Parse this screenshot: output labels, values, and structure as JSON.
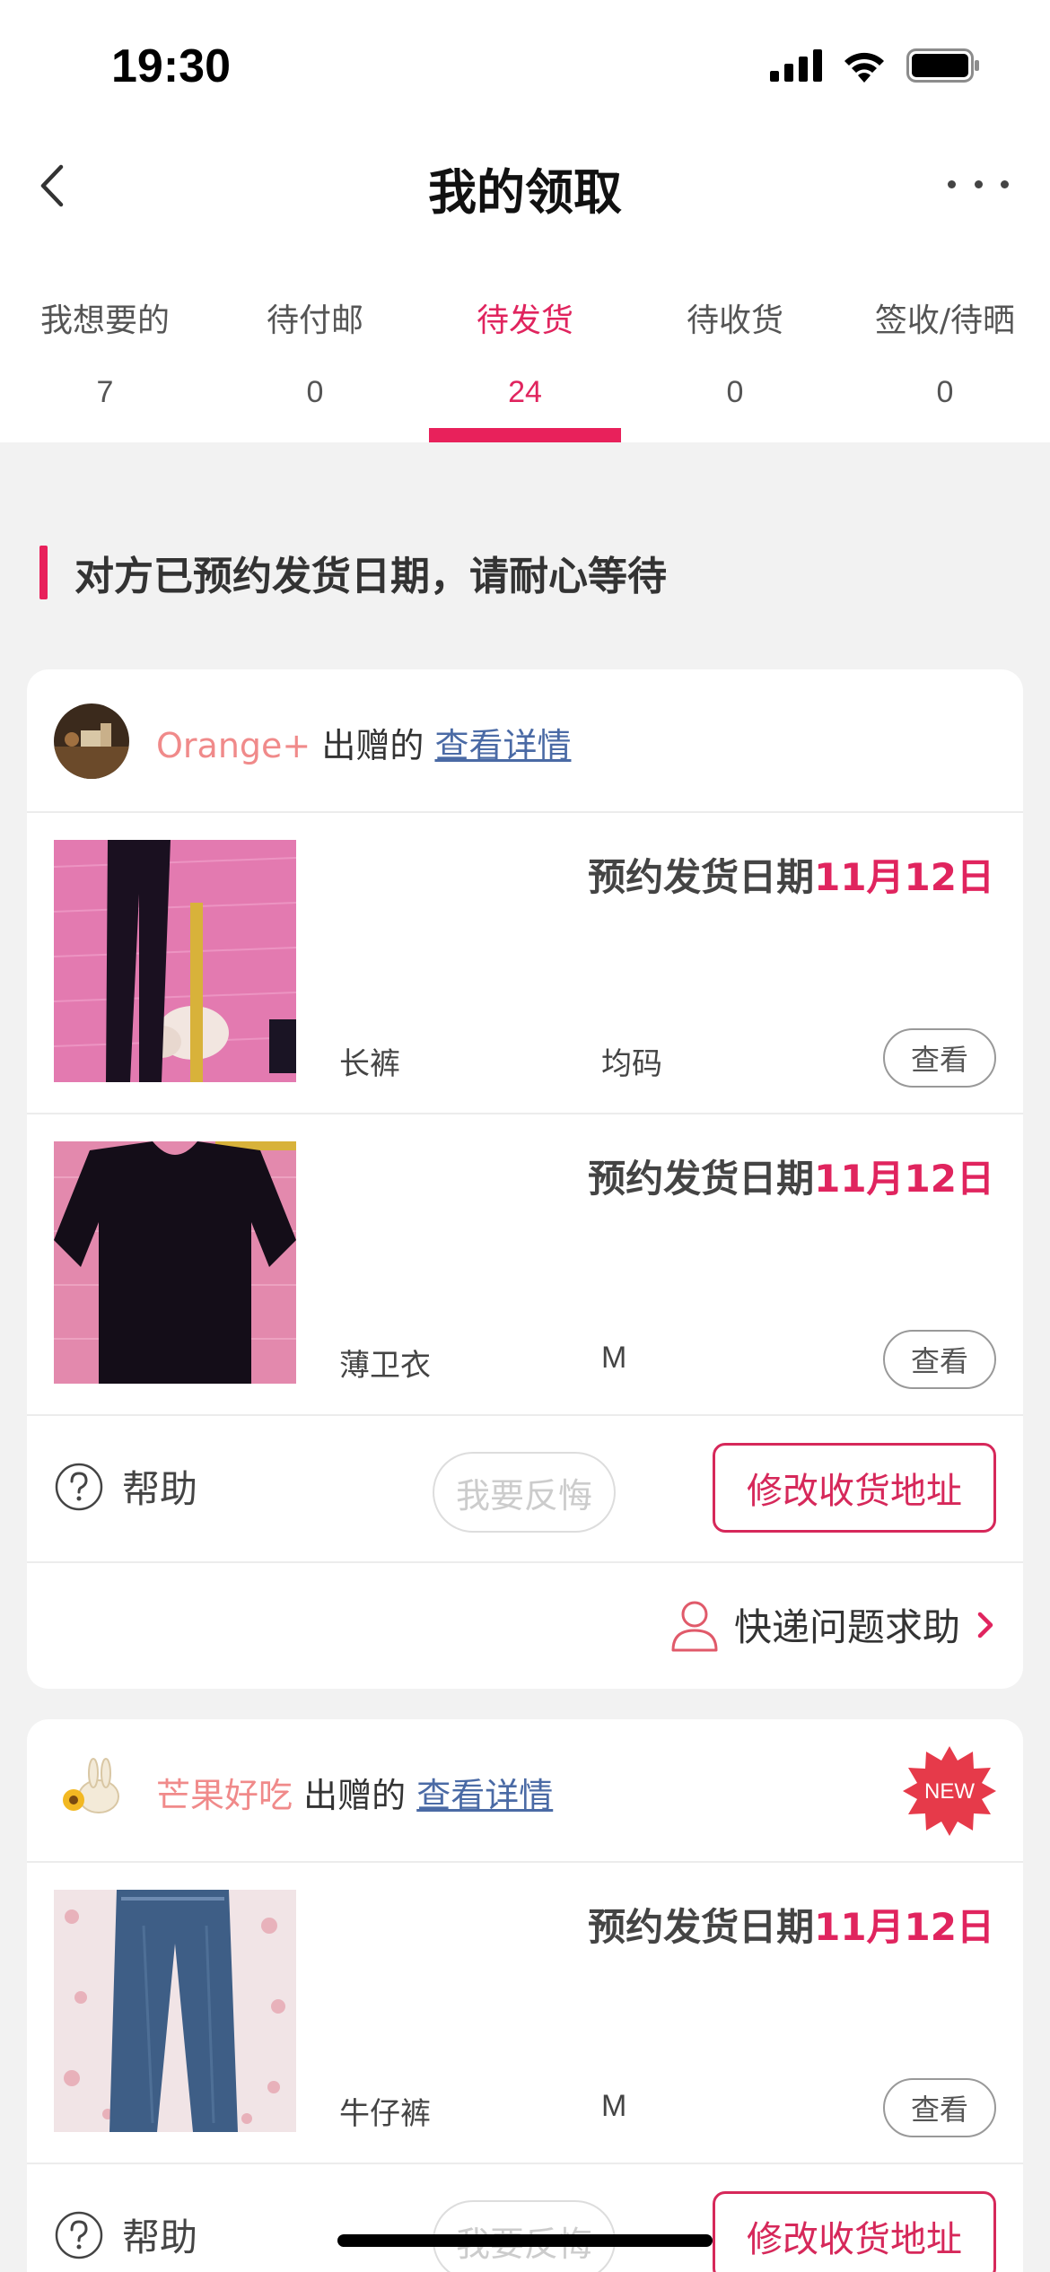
{
  "status_bar": {
    "time": "19:30"
  },
  "nav": {
    "title": "我的领取"
  },
  "tabs": [
    {
      "label": "我想要的",
      "count": "7"
    },
    {
      "label": "待付邮",
      "count": "0"
    },
    {
      "label": "待发货",
      "count": "24"
    },
    {
      "label": "待收货",
      "count": "0"
    },
    {
      "label": "签收/待晒",
      "count": "0"
    }
  ],
  "active_tab": "待发货",
  "notice": "对方已预约发货日期，请耐心等待",
  "cards": [
    {
      "giver_name": "Orange+",
      "giver_suffix": "出赠的",
      "detail_link": "查看详情",
      "items": [
        {
          "date_label": "预约发货日期",
          "date_value": "11月12日",
          "name": "长裤",
          "size": "均码",
          "view": "查看"
        },
        {
          "date_label": "预约发货日期",
          "date_value": "11月12日",
          "name": "薄卫衣",
          "size": "M",
          "view": "查看"
        }
      ],
      "help": "帮助",
      "regret": "我要反悔",
      "change_address": "修改收货地址",
      "express_help": "快递问题求助"
    },
    {
      "giver_name": "芒果好吃",
      "giver_suffix": "出赠的",
      "detail_link": "查看详情",
      "badge": "NEW",
      "items": [
        {
          "date_label": "预约发货日期",
          "date_value": "11月12日",
          "name": "牛仔裤",
          "size": "M",
          "view": "查看"
        }
      ],
      "help": "帮助",
      "regret": "我要反悔",
      "change_address": "修改收货地址"
    }
  ],
  "colors": {
    "accent": "#e8215b",
    "giver_name": "#f08a8a",
    "link": "#4a6aa5"
  }
}
